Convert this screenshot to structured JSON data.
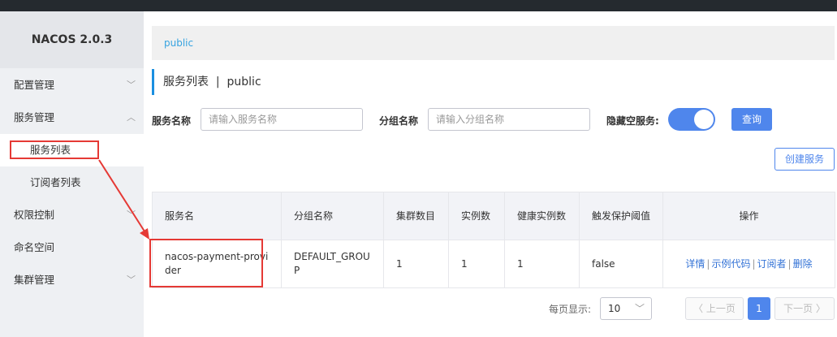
{
  "app": {
    "brand": "NACOS 2.0.3"
  },
  "sidebar": {
    "items": [
      {
        "label": "配置管理",
        "chevron": "﹀"
      },
      {
        "label": "服务管理",
        "chevron": "︿"
      },
      {
        "label": "服务列表"
      },
      {
        "label": "订阅者列表"
      },
      {
        "label": "权限控制",
        "chevron": "﹀"
      },
      {
        "label": "命名空间"
      },
      {
        "label": "集群管理",
        "chevron": "﹀"
      }
    ]
  },
  "breadcrumb": {
    "namespace": "public"
  },
  "page": {
    "title": "服务列表  |  public"
  },
  "filters": {
    "service_name_label": "服务名称",
    "service_name_placeholder": "请输入服务名称",
    "group_name_label": "分组名称",
    "group_name_placeholder": "请输入分组名称",
    "hide_empty_label": "隐藏空服务:",
    "hide_empty_on": true,
    "query_button": "查询",
    "create_button": "创建服务"
  },
  "table": {
    "headers": [
      "服务名",
      "分组名称",
      "集群数目",
      "实例数",
      "健康实例数",
      "触发保护阈值",
      "操作"
    ],
    "rows": [
      {
        "service": "nacos-payment-provider",
        "group": "DEFAULT_GROUP",
        "clusters": "1",
        "instances": "1",
        "healthy": "1",
        "threshold": "false",
        "ops": [
          "详情",
          "示例代码",
          "订阅者",
          "删除"
        ]
      }
    ]
  },
  "pager": {
    "page_size_label": "每页显示:",
    "page_size": "10",
    "prev": "上一页",
    "current": "1",
    "next": "下一页"
  },
  "colors": {
    "primary": "#4f86ec",
    "annotation": "#e53935"
  }
}
